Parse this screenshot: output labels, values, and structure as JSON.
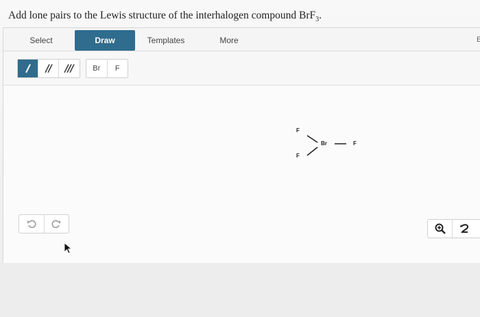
{
  "question": {
    "text": "Add lone pairs to the Lewis structure of the interhalogen compound BrF",
    "subscript": "3",
    "end": "."
  },
  "tabs": {
    "select": "Select",
    "draw": "Draw",
    "templates": "Templates",
    "more": "More",
    "edge": "E"
  },
  "tools": {
    "bonds": [
      "single-bond",
      "double-bond",
      "triple-bond"
    ],
    "atoms": [
      "Br",
      "F"
    ]
  },
  "molecule": {
    "atoms": [
      "F",
      "F",
      "Br",
      "F"
    ]
  },
  "colors": {
    "accent": "#2f6c8e"
  }
}
